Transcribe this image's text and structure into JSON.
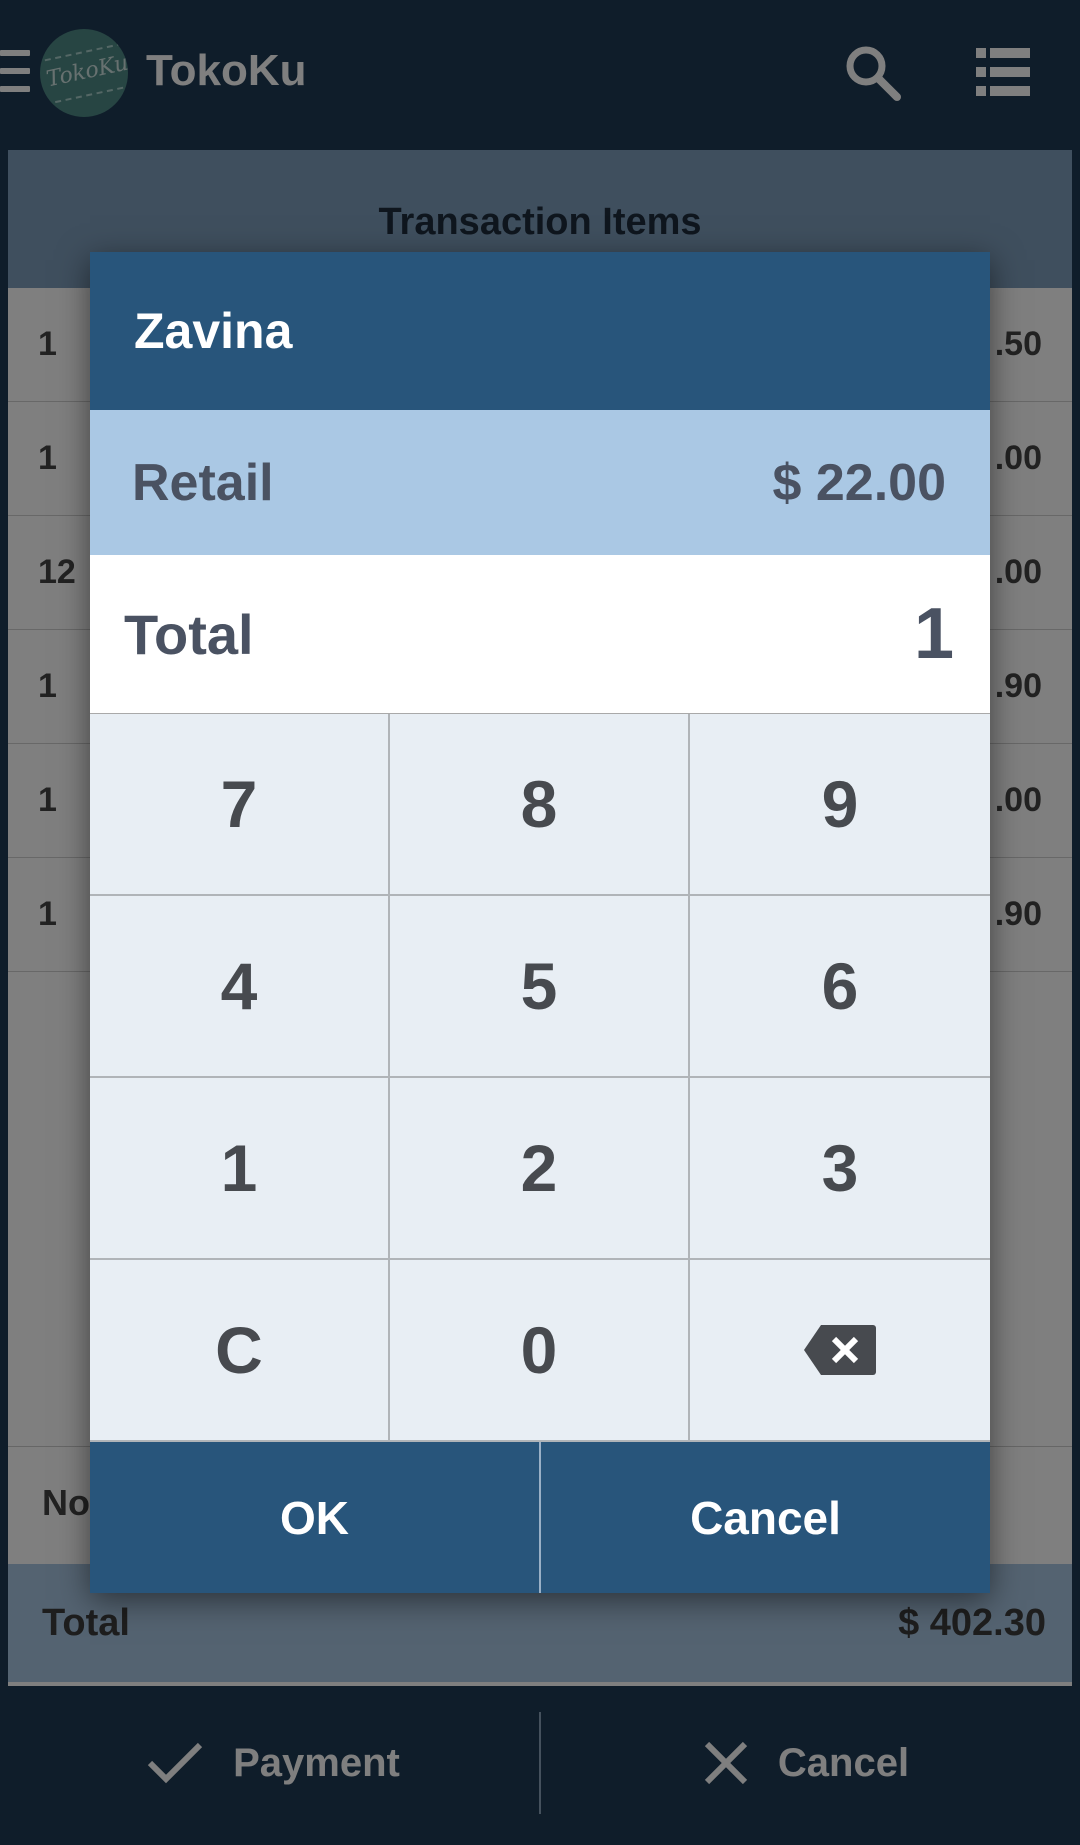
{
  "app": {
    "title": "TokoKu",
    "logo_text": "TokoKu"
  },
  "main": {
    "section_title": "Transaction Items",
    "rows": [
      {
        "qty": "1",
        "amount": ".50"
      },
      {
        "qty": "1",
        "amount": ".00"
      },
      {
        "qty": "12",
        "amount": ".00"
      },
      {
        "qty": "1",
        "amount": ".90"
      },
      {
        "qty": "1",
        "amount": ".00"
      },
      {
        "qty": "1",
        "amount": ".90"
      }
    ],
    "notes_label": "No",
    "total_label": "Total",
    "total_value": "$ 402.30"
  },
  "footer": {
    "payment_label": "Payment",
    "cancel_label": "Cancel"
  },
  "dialog": {
    "title": "Zavina",
    "price_label": "Retail",
    "price_value": "$ 22.00",
    "total_label": "Total",
    "total_value": "1",
    "keys": [
      "7",
      "8",
      "9",
      "4",
      "5",
      "6",
      "1",
      "2",
      "3",
      "C",
      "0"
    ],
    "ok_label": "OK",
    "cancel_label": "Cancel"
  },
  "colors": {
    "primary": "#28557b",
    "appbar": "#1f3b55",
    "price_band": "#aac8e4",
    "keypad_bg": "#e8eef4"
  }
}
